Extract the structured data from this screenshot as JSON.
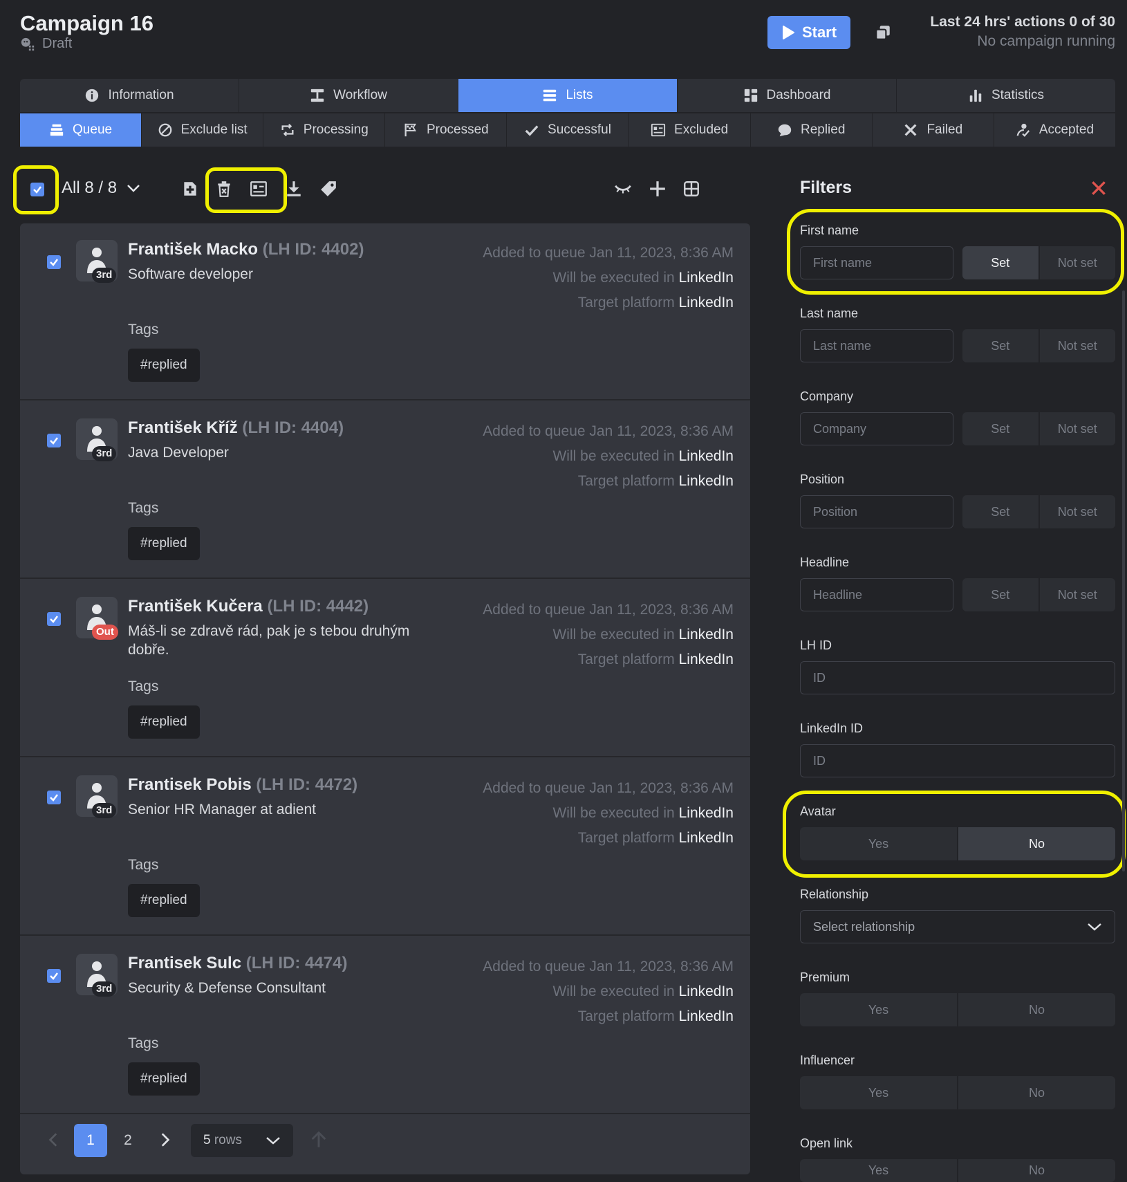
{
  "header": {
    "title": "Campaign 16",
    "status": "Draft",
    "start_label": "Start",
    "actions_line1": "Last 24 hrs' actions 0 of 30",
    "actions_line2": "No campaign running"
  },
  "main_tabs": [
    {
      "label": "Information",
      "icon": "info-icon"
    },
    {
      "label": "Workflow",
      "icon": "workflow-icon"
    },
    {
      "label": "Lists",
      "icon": "list-icon",
      "active": true
    },
    {
      "label": "Dashboard",
      "icon": "dashboard-icon"
    },
    {
      "label": "Statistics",
      "icon": "statistics-icon"
    }
  ],
  "sub_tabs": [
    {
      "label": "Queue",
      "icon": "queue-icon",
      "active": true
    },
    {
      "label": "Exclude list",
      "icon": "exclude-icon"
    },
    {
      "label": "Processing",
      "icon": "processing-icon"
    },
    {
      "label": "Processed",
      "icon": "flag-icon"
    },
    {
      "label": "Successful",
      "icon": "check-icon"
    },
    {
      "label": "Excluded",
      "icon": "excluded-icon"
    },
    {
      "label": "Replied",
      "icon": "replied-icon"
    },
    {
      "label": "Failed",
      "icon": "x-icon"
    },
    {
      "label": "Accepted",
      "icon": "accepted-icon"
    }
  ],
  "toolbar": {
    "selection_label": "All 8 / 8"
  },
  "rows": [
    {
      "name": "František Macko",
      "lh_id": "(LH ID: 4402)",
      "degree": "3rd",
      "headline": "Software developer",
      "added": "Added to queue Jan 11, 2023, 8:36 AM",
      "executed_prefix": "Will be executed in",
      "executed_in": "LinkedIn",
      "target_prefix": "Target platform",
      "target": "LinkedIn",
      "tags_label": "Tags",
      "tag": "#replied"
    },
    {
      "name": "František Kříž",
      "lh_id": "(LH ID: 4404)",
      "degree": "3rd",
      "headline": "Java Developer",
      "added": "Added to queue Jan 11, 2023, 8:36 AM",
      "executed_prefix": "Will be executed in",
      "executed_in": "LinkedIn",
      "target_prefix": "Target platform",
      "target": "LinkedIn",
      "tags_label": "Tags",
      "tag": "#replied"
    },
    {
      "name": "František Kučera",
      "lh_id": "(LH ID: 4442)",
      "degree": "Out",
      "headline": "Máš-li se zdravě rád, pak je s tebou druhým dobře.",
      "added": "Added to queue Jan 11, 2023, 8:36 AM",
      "executed_prefix": "Will be executed in",
      "executed_in": "LinkedIn",
      "target_prefix": "Target platform",
      "target": "LinkedIn",
      "tags_label": "Tags",
      "tag": "#replied"
    },
    {
      "name": "Frantisek Pobis",
      "lh_id": "(LH ID: 4472)",
      "degree": "3rd",
      "headline": "Senior HR Manager at adient",
      "added": "Added to queue Jan 11, 2023, 8:36 AM",
      "executed_prefix": "Will be executed in",
      "executed_in": "LinkedIn",
      "target_prefix": "Target platform",
      "target": "LinkedIn",
      "tags_label": "Tags",
      "tag": "#replied"
    },
    {
      "name": "Frantisek Sulc",
      "lh_id": "(LH ID: 4474)",
      "degree": "3rd",
      "headline": "Security & Defense Consultant",
      "added": "Added to queue Jan 11, 2023, 8:36 AM",
      "executed_prefix": "Will be executed in",
      "executed_in": "LinkedIn",
      "target_prefix": "Target platform",
      "target": "LinkedIn",
      "tags_label": "Tags",
      "tag": "#replied"
    }
  ],
  "pagination": {
    "pages": [
      "1",
      "2"
    ],
    "current": "1",
    "rows_value": "5",
    "rows_label": "rows"
  },
  "filters": {
    "title": "Filters",
    "first_name": {
      "label": "First name",
      "placeholder": "First name",
      "set": "Set",
      "not_set": "Not set"
    },
    "last_name": {
      "label": "Last name",
      "placeholder": "Last name",
      "set": "Set",
      "not_set": "Not set"
    },
    "company": {
      "label": "Company",
      "placeholder": "Company",
      "set": "Set",
      "not_set": "Not set"
    },
    "position": {
      "label": "Position",
      "placeholder": "Position",
      "set": "Set",
      "not_set": "Not set"
    },
    "headline": {
      "label": "Headline",
      "placeholder": "Headline",
      "set": "Set",
      "not_set": "Not set"
    },
    "lh_id": {
      "label": "LH ID",
      "placeholder": "ID"
    },
    "linkedin_id": {
      "label": "LinkedIn ID",
      "placeholder": "ID"
    },
    "avatar": {
      "label": "Avatar",
      "yes": "Yes",
      "no": "No"
    },
    "relationship": {
      "label": "Relationship",
      "placeholder": "Select relationship"
    },
    "premium": {
      "label": "Premium",
      "yes": "Yes",
      "no": "No"
    },
    "influencer": {
      "label": "Influencer",
      "yes": "Yes",
      "no": "No"
    },
    "open_link": {
      "label": "Open link",
      "yes": "Yes",
      "no": "No"
    }
  },
  "colors": {
    "accent": "#5b8df0",
    "highlight": "#f0f000",
    "danger": "#e0544e",
    "background": "#222327",
    "panel": "#34363d"
  }
}
